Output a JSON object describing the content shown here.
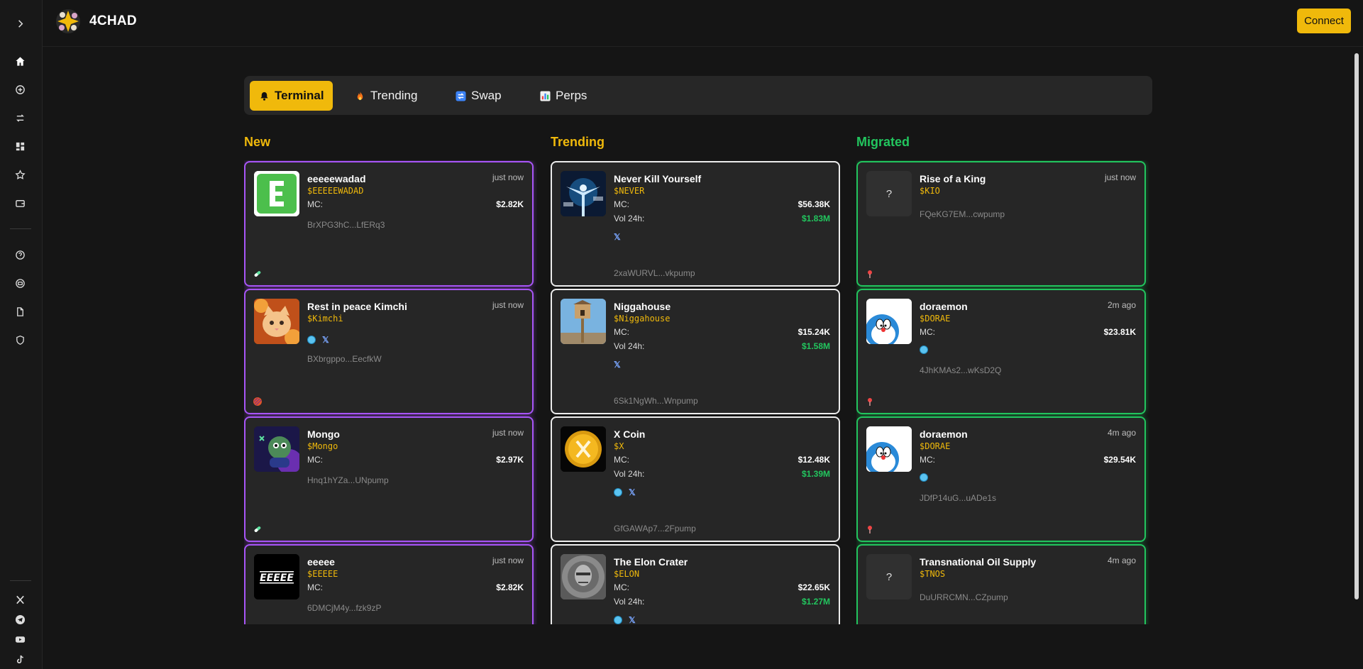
{
  "app": {
    "brand": "4CHAD",
    "connect_label": "Connect"
  },
  "tabs": [
    {
      "label": "Terminal",
      "icon": "bell-icon",
      "active": true
    },
    {
      "label": "Trending",
      "icon": "fire-icon",
      "active": false
    },
    {
      "label": "Swap",
      "icon": "swap-icon",
      "active": false
    },
    {
      "label": "Perps",
      "icon": "bar-chart-icon",
      "active": false
    }
  ],
  "columns": {
    "new": {
      "title": "New",
      "color": "#f0b90b"
    },
    "trending": {
      "title": "Trending",
      "color": "#f0b90b"
    },
    "migrated": {
      "title": "Migrated",
      "color": "#22c55e"
    }
  },
  "labels": {
    "mc": "MC:",
    "vol": "Vol 24h:"
  },
  "new_cards": [
    {
      "name": "eeeeewadad",
      "ticker": "$EEEEEWADAD",
      "time": "just now",
      "mc": "$2.82K",
      "address": "BrXPG3hC...LfERq3",
      "social_globe": false,
      "social_x": false,
      "badge": "pill-icon"
    },
    {
      "name": "Rest in peace Kimchi",
      "ticker": "$Kimchi",
      "time": "just now",
      "mc": "",
      "address": "BXbrgppo...EecfkW",
      "social_globe": true,
      "social_x": true,
      "badge": "fire-orb-icon"
    },
    {
      "name": "Mongo",
      "ticker": "$Mongo",
      "time": "just now",
      "mc": "$2.97K",
      "address": "Hnq1hYZa...UNpump",
      "social_globe": false,
      "social_x": false,
      "badge": "pill-icon"
    },
    {
      "name": "eeeee",
      "ticker": "$EEEEE",
      "time": "just now",
      "mc": "$2.82K",
      "address": "6DMCjM4y...fzk9zP",
      "social_globe": false,
      "social_x": false,
      "badge": ""
    }
  ],
  "trending_cards": [
    {
      "name": "Never Kill Yourself",
      "ticker": "$NEVER",
      "mc": "$56.38K",
      "vol": "$1.83M",
      "address": "2xaWURVL...vkpump",
      "social_globe": false,
      "social_x": true
    },
    {
      "name": "Niggahouse",
      "ticker": "$Niggahouse",
      "mc": "$15.24K",
      "vol": "$1.58M",
      "address": "6Sk1NgWh...Wnpump",
      "social_globe": false,
      "social_x": true
    },
    {
      "name": "X Coin",
      "ticker": "$X",
      "mc": "$12.48K",
      "vol": "$1.39M",
      "address": "GfGAWAp7...2Fpump",
      "social_globe": true,
      "social_x": true
    },
    {
      "name": "The Elon Crater",
      "ticker": "$ELON",
      "mc": "$22.65K",
      "vol": "$1.27M",
      "address": "",
      "social_globe": true,
      "social_x": true
    }
  ],
  "migrated_cards": [
    {
      "name": "Rise of a King",
      "ticker": "$KIO",
      "time": "just now",
      "mc": "",
      "address": "FQeKG7EM...cwpump",
      "placeholder": "?",
      "social_globe": false,
      "badge": "pin-icon"
    },
    {
      "name": "doraemon",
      "ticker": "$DORAE",
      "time": "2m ago",
      "mc": "$23.81K",
      "address": "4JhKMAs2...wKsD2Q",
      "placeholder": "",
      "social_globe": true,
      "badge": "pin-icon"
    },
    {
      "name": "doraemon",
      "ticker": "$DORAE",
      "time": "4m ago",
      "mc": "$29.54K",
      "address": "JDfP14uG...uADe1s",
      "placeholder": "",
      "social_globe": true,
      "badge": "pin-icon"
    },
    {
      "name": "Transnational Oil Supply",
      "ticker": "$TNOS",
      "time": "4m ago",
      "mc": "",
      "address": "DuURRCMN...CZpump",
      "placeholder": "?",
      "social_globe": false,
      "badge": ""
    }
  ],
  "sidebar": {
    "items": [
      {
        "icon": "chevron-right-icon"
      },
      {
        "icon": "home-icon"
      },
      {
        "icon": "plus-circle-icon"
      },
      {
        "icon": "swap-icon"
      },
      {
        "icon": "dashboard-icon"
      },
      {
        "icon": "star-icon"
      },
      {
        "icon": "wallet-icon"
      },
      {
        "icon": "help-icon"
      },
      {
        "icon": "robot-icon"
      },
      {
        "icon": "document-icon"
      },
      {
        "icon": "shield-icon"
      }
    ],
    "socials": [
      {
        "icon": "x-icon"
      },
      {
        "icon": "telegram-icon"
      },
      {
        "icon": "youtube-icon"
      },
      {
        "icon": "tiktok-icon"
      }
    ]
  }
}
